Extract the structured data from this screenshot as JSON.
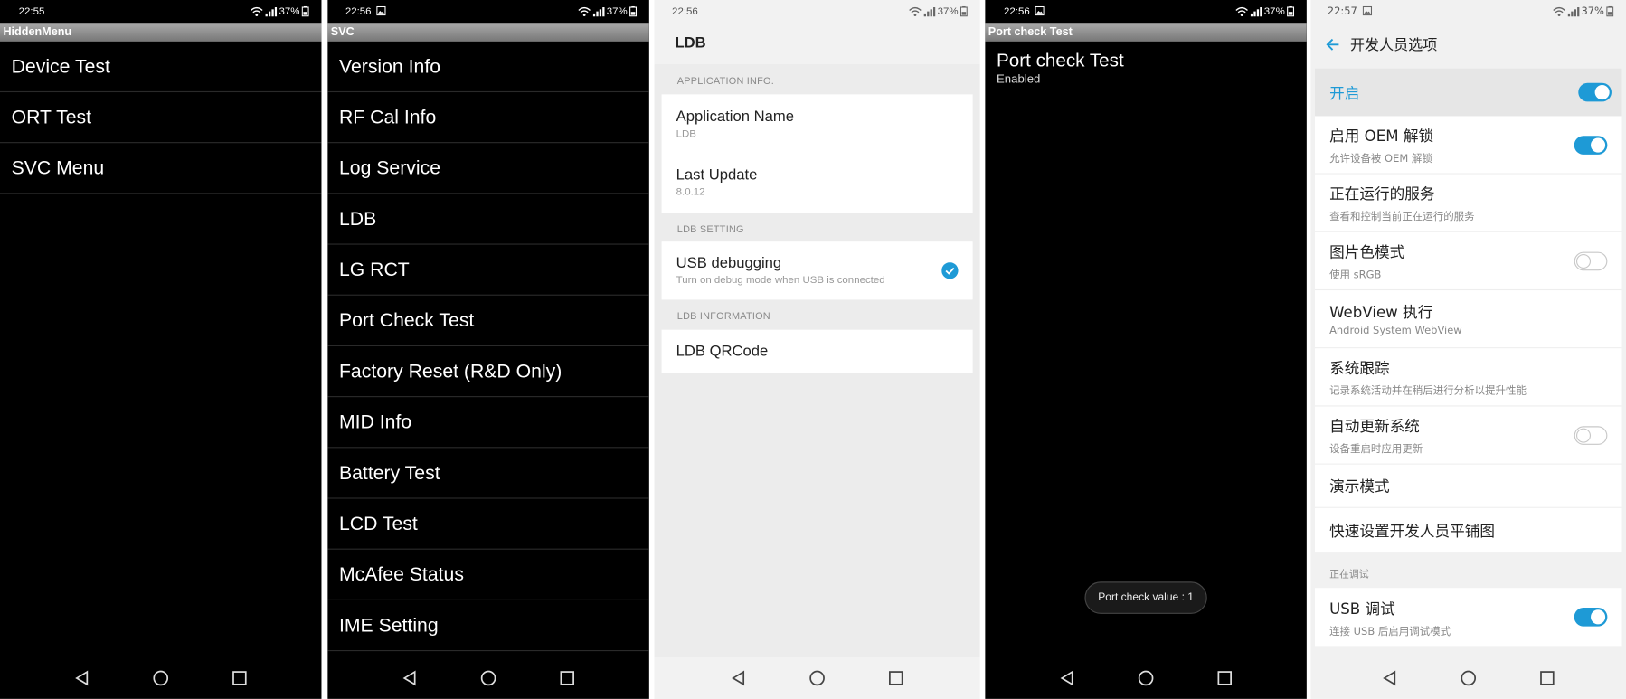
{
  "panel1": {
    "time": "22:55",
    "battery": "37%",
    "bar_title": "HiddenMenu",
    "items": [
      "Device Test",
      "ORT Test",
      "SVC Menu"
    ]
  },
  "panel2": {
    "time": "22:56",
    "battery": "37%",
    "bar_title": "SVC",
    "items": [
      "Version Info",
      "RF Cal Info",
      "Log Service",
      "LDB",
      "LG RCT",
      "Port Check Test",
      "Factory Reset (R&D Only)",
      "MID Info",
      "Battery Test",
      "LCD Test",
      "McAfee Status",
      "IME Setting"
    ]
  },
  "panel3": {
    "time": "22:56",
    "battery": "37%",
    "title": "LDB",
    "section1": "APPLICATION INFO.",
    "app_name_label": "Application Name",
    "app_name_value": "LDB",
    "last_update_label": "Last Update",
    "last_update_value": "8.0.12",
    "section2": "LDB SETTING",
    "usb_debugging_label": "USB debugging",
    "usb_debugging_desc": "Turn on debug mode when USB is connected",
    "section3": "LDB INFORMATION",
    "qrcode_label": "LDB QRCode"
  },
  "panel4": {
    "time": "22:56",
    "battery": "37%",
    "bar_title": "Port check Test",
    "item_title": "Port check Test",
    "item_sub": "Enabled",
    "toast": "Port check value : 1"
  },
  "panel5": {
    "time": "22:57",
    "battery": "37%",
    "title": "开发人员选项",
    "master": "开启",
    "oem_title": "启用 OEM 解锁",
    "oem_sub": "允许设备被 OEM 解锁",
    "running_title": "正在运行的服务",
    "running_sub": "查看和控制当前正在运行的服务",
    "color_title": "图片色模式",
    "color_sub": "使用 sRGB",
    "webview_title": "WebView 执行",
    "webview_sub": "Android System WebView",
    "trace_title": "系统跟踪",
    "trace_sub": "记录系统活动并在稍后进行分析以提升性能",
    "autoupdate_title": "自动更新系统",
    "autoupdate_sub": "设备重启时应用更新",
    "demo_title": "演示模式",
    "quicktile_title": "快速设置开发人员平铺图",
    "debug_section": "正在调试",
    "usb_title": "USB 调试",
    "usb_sub": "连接 USB 后启用调试模式"
  },
  "colors": {
    "accent_blue": "#1e9ad6"
  },
  "icons": [
    "wifi-icon",
    "signal-icon",
    "battery-icon",
    "image-icon",
    "back-icon",
    "home-icon",
    "recents-icon",
    "check-icon",
    "arrow-back-icon"
  ]
}
